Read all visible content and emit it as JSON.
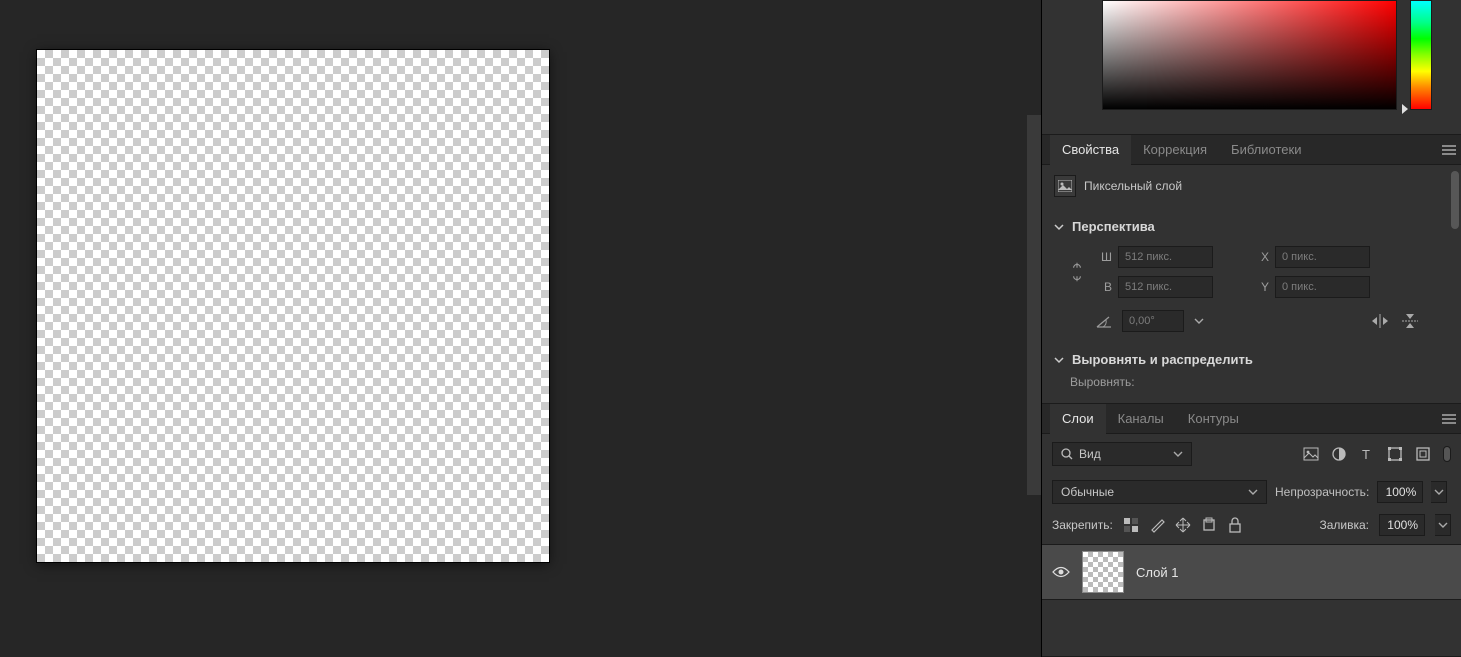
{
  "panels": {
    "properties": {
      "tabs": [
        "Свойства",
        "Коррекция",
        "Библиотеки"
      ],
      "activeTab": 0,
      "layerType": "Пиксельный слой",
      "sections": {
        "transform": {
          "title": "Перспектива",
          "wLabel": "Ш",
          "wValue": "512 пикс.",
          "hLabel": "В",
          "hValue": "512 пикс.",
          "xLabel": "X",
          "xValue": "0 пикс.",
          "yLabel": "Y",
          "yValue": "0 пикс.",
          "angleValue": "0,00°"
        },
        "align": {
          "title": "Выровнять и распределить",
          "alignLabel": "Выровнять:"
        }
      }
    },
    "layers": {
      "tabs": [
        "Слои",
        "Каналы",
        "Контуры"
      ],
      "activeTab": 0,
      "filterKind": "Вид",
      "blendMode": "Обычные",
      "opacityLabel": "Непрозрачность:",
      "opacityValue": "100%",
      "lockLabel": "Закрепить:",
      "fillLabel": "Заливка:",
      "fillValue": "100%",
      "items": [
        {
          "name": "Слой 1",
          "visible": true
        }
      ]
    }
  }
}
